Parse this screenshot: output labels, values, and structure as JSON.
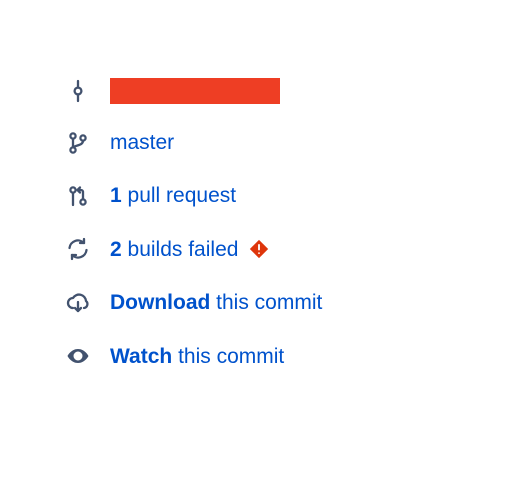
{
  "commit": {
    "hash_redacted": true
  },
  "branch": {
    "name": "master"
  },
  "pull_requests": {
    "count": "1",
    "label_suffix": " pull request"
  },
  "builds": {
    "count": "2",
    "label_suffix": " builds failed",
    "status": "failed"
  },
  "download": {
    "action": "Download",
    "label_suffix": " this commit"
  },
  "watch": {
    "action": "Watch",
    "label_suffix": " this commit"
  }
}
